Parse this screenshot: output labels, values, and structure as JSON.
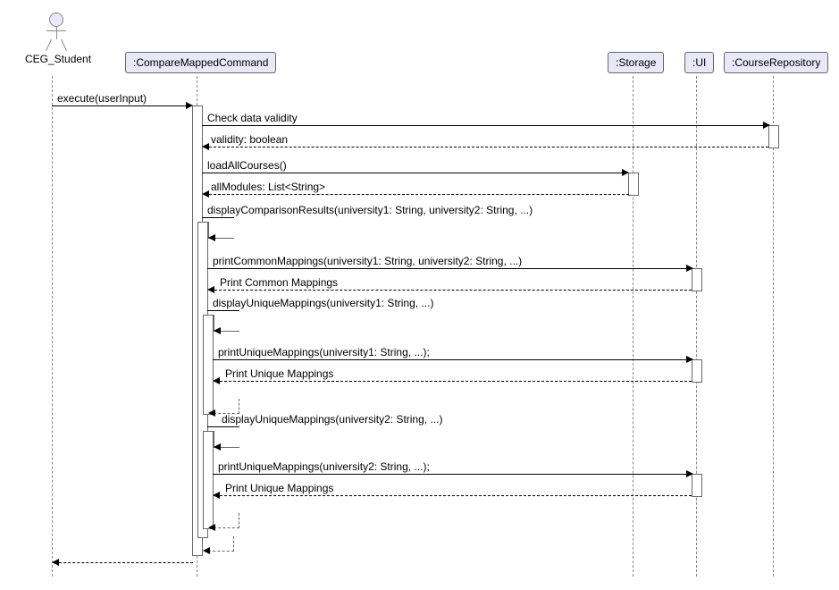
{
  "actor": {
    "name": "CEG_Student"
  },
  "participants": {
    "cmd": ":CompareMappedCommand",
    "storage": ":Storage",
    "ui": ":UI",
    "repo": ":CourseRepository"
  },
  "messages": {
    "m1": "execute(userInput)",
    "m2": "Check data validity",
    "m3": "validity: boolean",
    "m4": "loadAllCourses()",
    "m5": "allModules: List<String>",
    "m6": "displayComparisonResults(university1: String, university2: String, ...)",
    "m7": "printCommonMappings(university1: String, university2: String, ...)",
    "m8": "Print Common Mappings",
    "m9": "displayUniqueMappings(university1: String, ...)",
    "m10": "printUniqueMappings(university1: String, ...);",
    "m11": "Print Unique Mappings",
    "m12": "displayUniqueMappings(university2: String, ...)",
    "m13": "printUniqueMappings(university2: String, ...);",
    "m14": "Print Unique Mappings"
  },
  "positions": {
    "actorX": 48,
    "cmdX": 210,
    "storageX": 698,
    "uiX": 769,
    "repoX": 855
  }
}
